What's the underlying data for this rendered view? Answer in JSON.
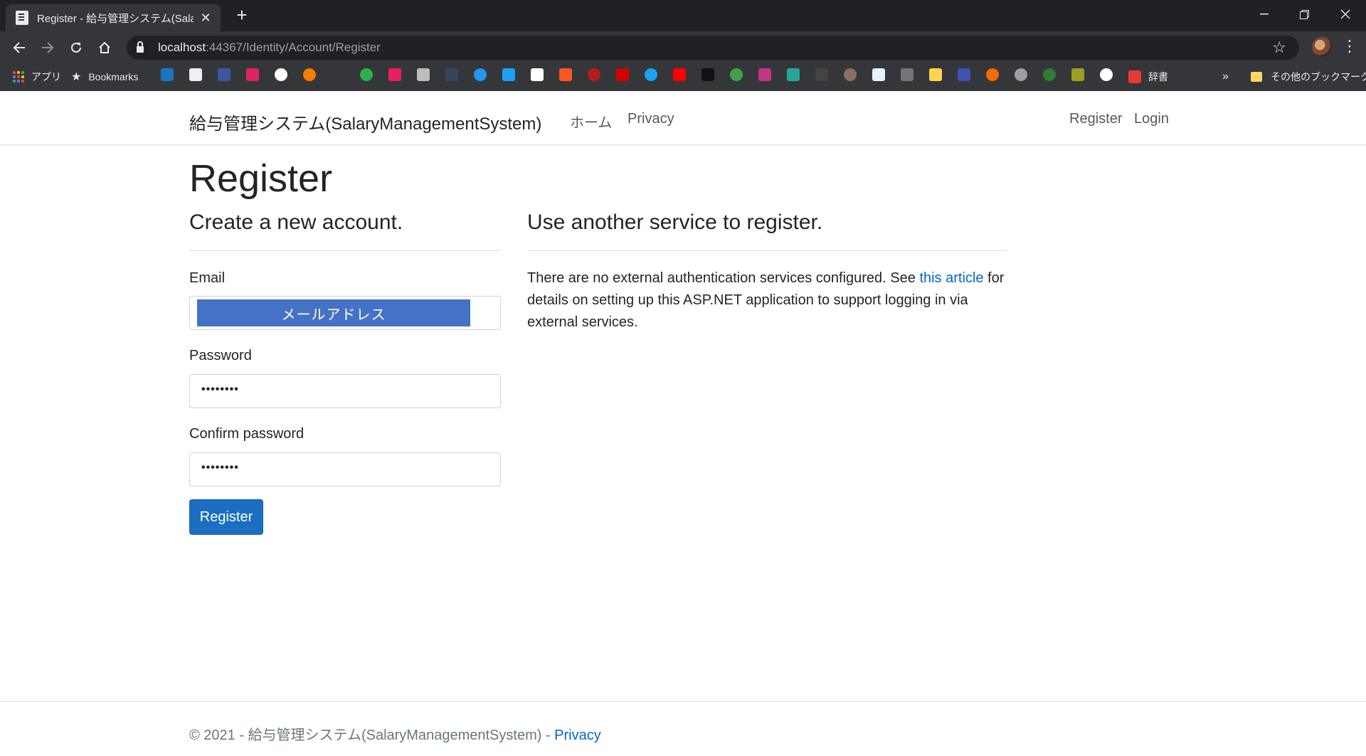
{
  "browser": {
    "tab_title": "Register - 給与管理システム(Salary",
    "url_host": "localhost",
    "url_path": ":44367/Identity/Account/Register",
    "bookmarks": {
      "apps_label": "アプリ",
      "bookmarks_label": "Bookmarks",
      "dictionary_label": "辞書",
      "overflow_label": "»",
      "other_label": "その他のブックマーク"
    }
  },
  "header": {
    "brand": "給与管理システム(SalaryManagementSystem)",
    "nav": {
      "home": "ホーム",
      "privacy": "Privacy",
      "register": "Register",
      "login": "Login"
    }
  },
  "main": {
    "title": "Register",
    "form": {
      "heading": "Create a new account.",
      "email_label": "Email",
      "email_value": "メールアドレス",
      "password_label": "Password",
      "password_value": "••••••••",
      "confirm_label": "Confirm password",
      "confirm_value": "••••••••",
      "submit_label": "Register"
    },
    "external": {
      "heading": "Use another service to register.",
      "text_before": "There are no external authentication services configured. See ",
      "link_text": "this article",
      "text_after": " for details on setting up this ASP.NET application to support logging in via external services."
    }
  },
  "footer": {
    "copyright": "© 2021 - 給与管理システム(SalaryManagementSystem) - ",
    "privacy_link": "Privacy"
  },
  "colors": {
    "primary": "#1b6ec2",
    "link": "#0366d6",
    "email_highlight": "#4472c4",
    "chrome_dark": "#202124",
    "chrome_toolbar": "#35363a"
  }
}
